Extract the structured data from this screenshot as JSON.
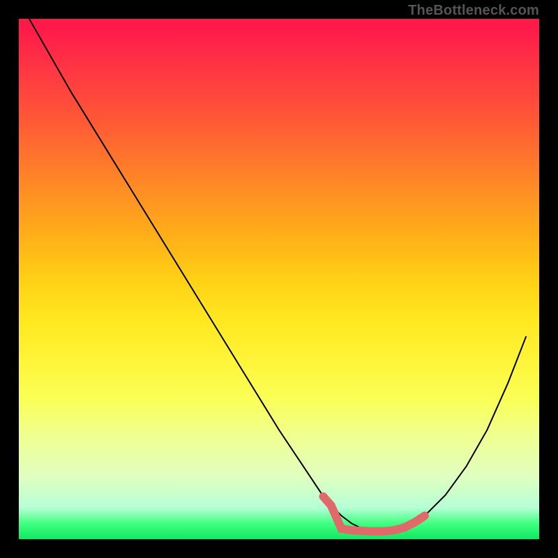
{
  "watermark": "TheBottleneck.com",
  "chart_data": {
    "type": "line",
    "title": "",
    "xlabel": "",
    "ylabel": "",
    "xlim": [
      0,
      100
    ],
    "ylim": [
      0,
      100
    ],
    "background_gradient": {
      "orientation": "vertical",
      "stops": [
        {
          "pos": 0,
          "color": "#ff1a4a"
        },
        {
          "pos": 50,
          "color": "#ffd015"
        },
        {
          "pos": 73,
          "color": "#faff55"
        },
        {
          "pos": 100,
          "color": "#10e860"
        }
      ]
    },
    "series": [
      {
        "name": "main-curve",
        "color": "#000000",
        "stroke_width": 2,
        "x": [
          2,
          6,
          10,
          14,
          18,
          22,
          26,
          30,
          34,
          38,
          42,
          46,
          50,
          54,
          58,
          60,
          62,
          64,
          66,
          68,
          70,
          72,
          74,
          78,
          82,
          86,
          90,
          94,
          97.5
        ],
        "y": [
          100,
          93,
          86,
          79.5,
          73,
          66.5,
          60,
          53.5,
          47,
          40.5,
          34,
          27.5,
          21,
          15,
          9,
          6.5,
          4.5,
          3,
          2,
          1.6,
          1.5,
          1.7,
          2.2,
          4.5,
          8.5,
          14,
          21,
          30,
          39
        ]
      },
      {
        "name": "highlight-segment",
        "color": "#e06a6a",
        "stroke_width": 12,
        "linecap": "round",
        "x": [
          58.5,
          60,
          62,
          64,
          66,
          68,
          70,
          72,
          74,
          76,
          78
        ],
        "y": [
          8.2,
          6.5,
          2,
          1.7,
          1.6,
          1.5,
          1.5,
          1.7,
          2.2,
          3.2,
          4.5
        ]
      }
    ]
  }
}
